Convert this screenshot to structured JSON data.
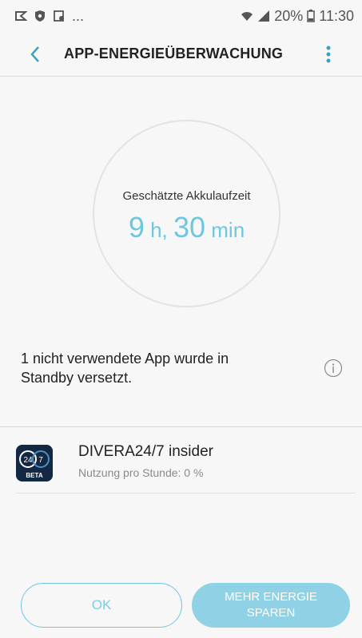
{
  "status_bar": {
    "dots": "...",
    "battery_percent": "20%",
    "time": "11:30"
  },
  "app_bar": {
    "title": "APP-ENERGIEÜBERWACHUNG"
  },
  "battery_estimate": {
    "label": "Geschätzte Akkulaufzeit",
    "hours": "9",
    "hours_unit": " h, ",
    "minutes": "30",
    "minutes_unit": " min"
  },
  "standby_notice": {
    "text": "1 nicht verwendete App wurde in Standby versetzt."
  },
  "apps": [
    {
      "name": "DIVERA24/7 insider",
      "usage": "Nutzung pro Stunde: 0 %",
      "icon_text_left": "24",
      "icon_text_right": "7",
      "icon_badge": "BETA"
    }
  ],
  "buttons": {
    "ok": "OK",
    "more_energy": "MEHR ENERGIE SPAREN"
  },
  "colors": {
    "accent": "#6ec6e0",
    "accent_button": "#8fd2e6",
    "background": "#f7f7f7",
    "app_icon_bg": "#122843"
  }
}
